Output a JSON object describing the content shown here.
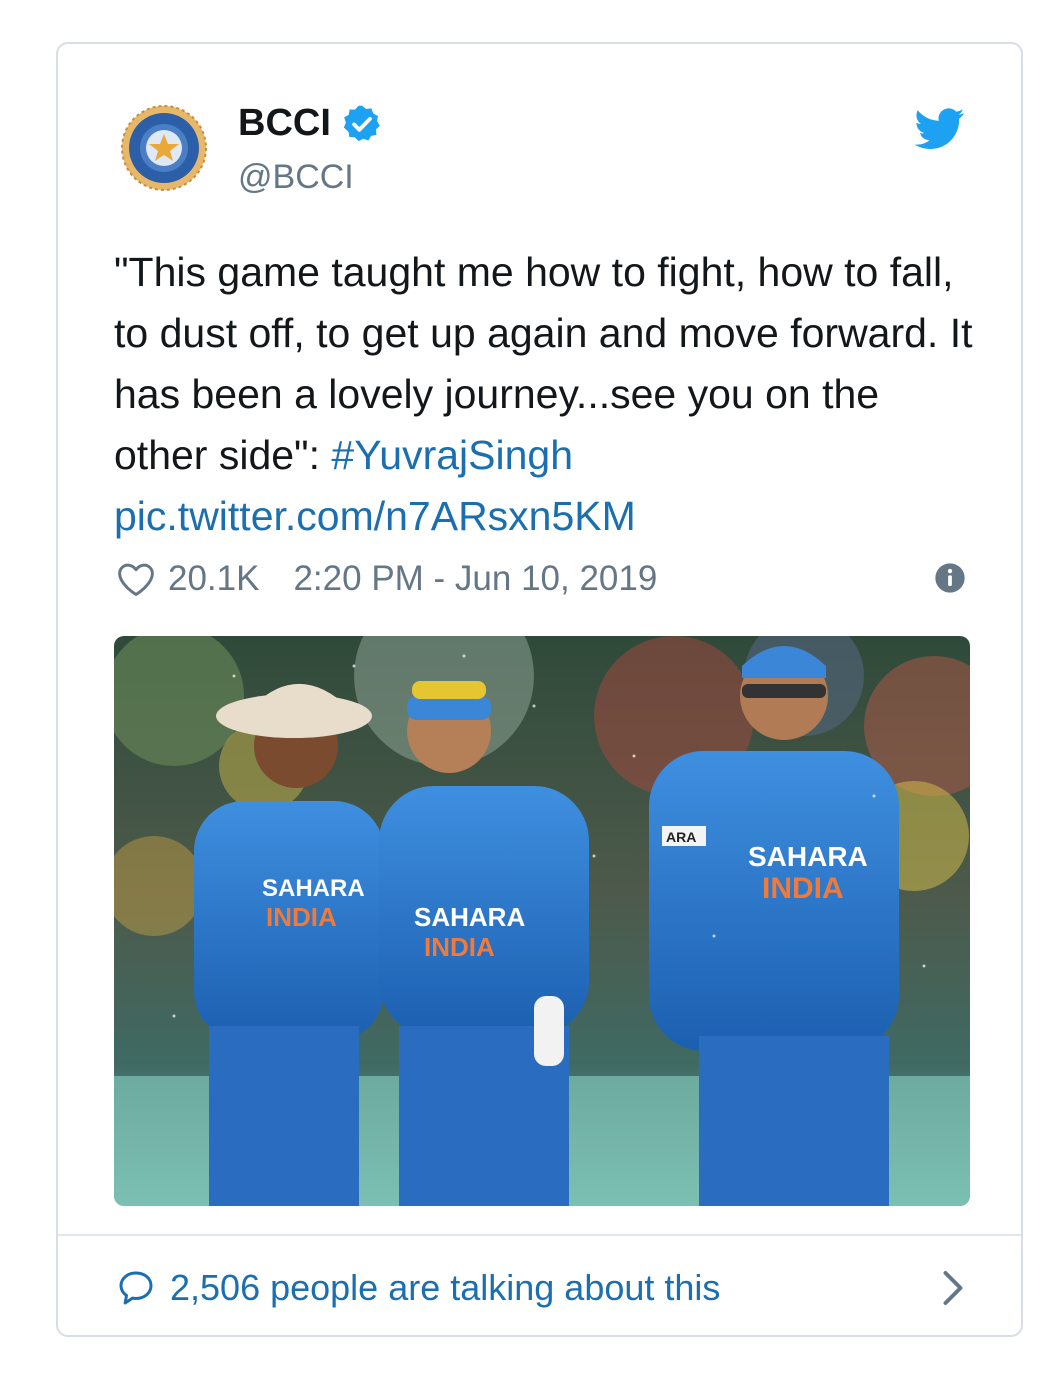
{
  "account": {
    "name": "BCCI",
    "handle": "@BCCI",
    "verified": true
  },
  "tweet": {
    "text": "\"This game taught me how to fight, how to fall, to dust off, to get up again and move forward. It has been a lovely journey...see you on the other side\": ",
    "hashtag": "#YuvrajSingh",
    "link": "pic.twitter.com/n7ARsxn5KM",
    "likes": "20.1K",
    "timestamp": "2:20 PM - Jun 10, 2019"
  },
  "photo": {
    "shirt_text_line1": "SAHARA",
    "shirt_text_line2": "INDIA",
    "sleeve_text": "ARA"
  },
  "footer": {
    "talking_label": "2,506 people are talking about this"
  },
  "icons": {
    "brand": "twitter-bird-icon",
    "verified": "verified-badge-icon",
    "like": "heart-icon",
    "info": "info-icon",
    "reply": "speech-bubble-icon",
    "chevron": "chevron-right-icon"
  },
  "colors": {
    "link": "#1b6fb0",
    "twitter_blue": "#1da1f2",
    "text": "#14171a",
    "secondary": "#657786",
    "border": "#d8dee3"
  }
}
